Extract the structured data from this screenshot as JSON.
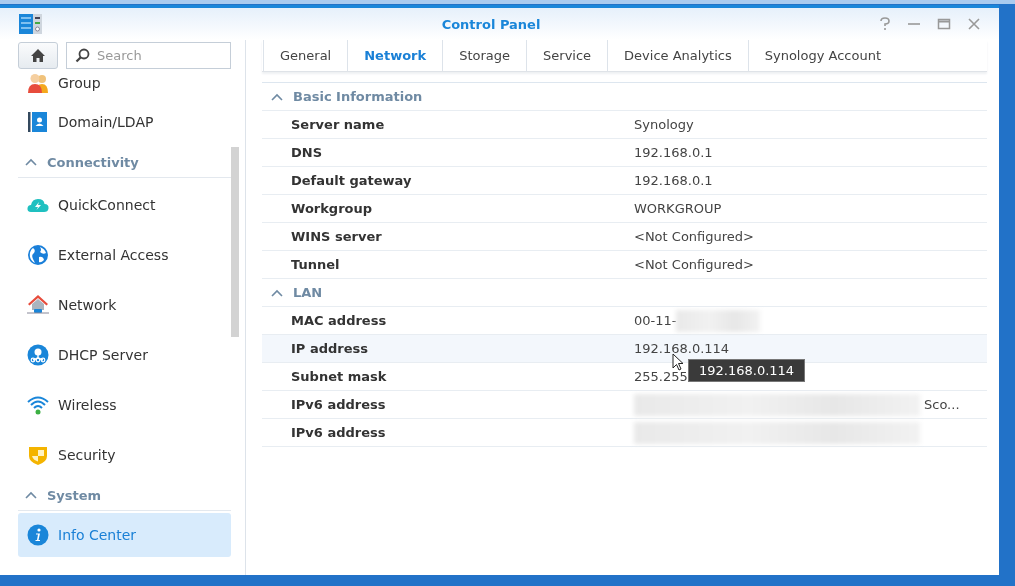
{
  "window": {
    "title": "Control Panel"
  },
  "sidebar": {
    "search": {
      "placeholder": "Search"
    },
    "items": [
      {
        "kind": "item",
        "label": "Group",
        "selected": false
      },
      {
        "kind": "item",
        "label": "Domain/LDAP",
        "selected": false
      },
      {
        "kind": "section",
        "label": "Connectivity",
        "expanded": true
      },
      {
        "kind": "item",
        "label": "QuickConnect",
        "selected": false
      },
      {
        "kind": "item",
        "label": "External Access",
        "selected": false
      },
      {
        "kind": "item",
        "label": "Network",
        "selected": false
      },
      {
        "kind": "item",
        "label": "DHCP Server",
        "selected": false
      },
      {
        "kind": "item",
        "label": "Wireless",
        "selected": false
      },
      {
        "kind": "item",
        "label": "Security",
        "selected": false
      },
      {
        "kind": "section",
        "label": "System",
        "expanded": true
      },
      {
        "kind": "item",
        "label": "Info Center",
        "selected": true
      }
    ]
  },
  "tabs": [
    {
      "label": "General",
      "selected": false
    },
    {
      "label": "Network",
      "selected": true
    },
    {
      "label": "Storage",
      "selected": false
    },
    {
      "label": "Service",
      "selected": false
    },
    {
      "label": "Device Analytics",
      "selected": false
    },
    {
      "label": "Synology Account",
      "selected": false
    }
  ],
  "groups": [
    {
      "title": "Basic Information",
      "expanded": true,
      "rows": [
        {
          "label": "Server name",
          "value": "Synology",
          "hovered": false
        },
        {
          "label": "DNS",
          "value": "192.168.0.1",
          "hovered": false
        },
        {
          "label": "Default gateway",
          "value": "192.168.0.1",
          "hovered": false
        },
        {
          "label": "Workgroup",
          "value": "WORKGROUP",
          "hovered": false
        },
        {
          "label": "WINS server",
          "value": "<Not Configured>",
          "hovered": false
        },
        {
          "label": "Tunnel",
          "value": "<Not Configured>",
          "hovered": false
        }
      ]
    },
    {
      "title": "LAN",
      "expanded": true,
      "rows": [
        {
          "kind": "partly-masked",
          "label": "MAC address",
          "value": "00-11-",
          "hovered": false
        },
        {
          "label": "IP address",
          "value": "192.168.0.114",
          "hovered": true,
          "tooltip": "192.168.0.114"
        },
        {
          "label": "Subnet mask",
          "value": "255.255",
          "hovered": false
        },
        {
          "kind": "masked",
          "label": "IPv6 address",
          "suffix": "Sco...",
          "hovered": false
        },
        {
          "kind": "masked",
          "label": "IPv6 address",
          "hovered": false
        }
      ]
    }
  ]
}
